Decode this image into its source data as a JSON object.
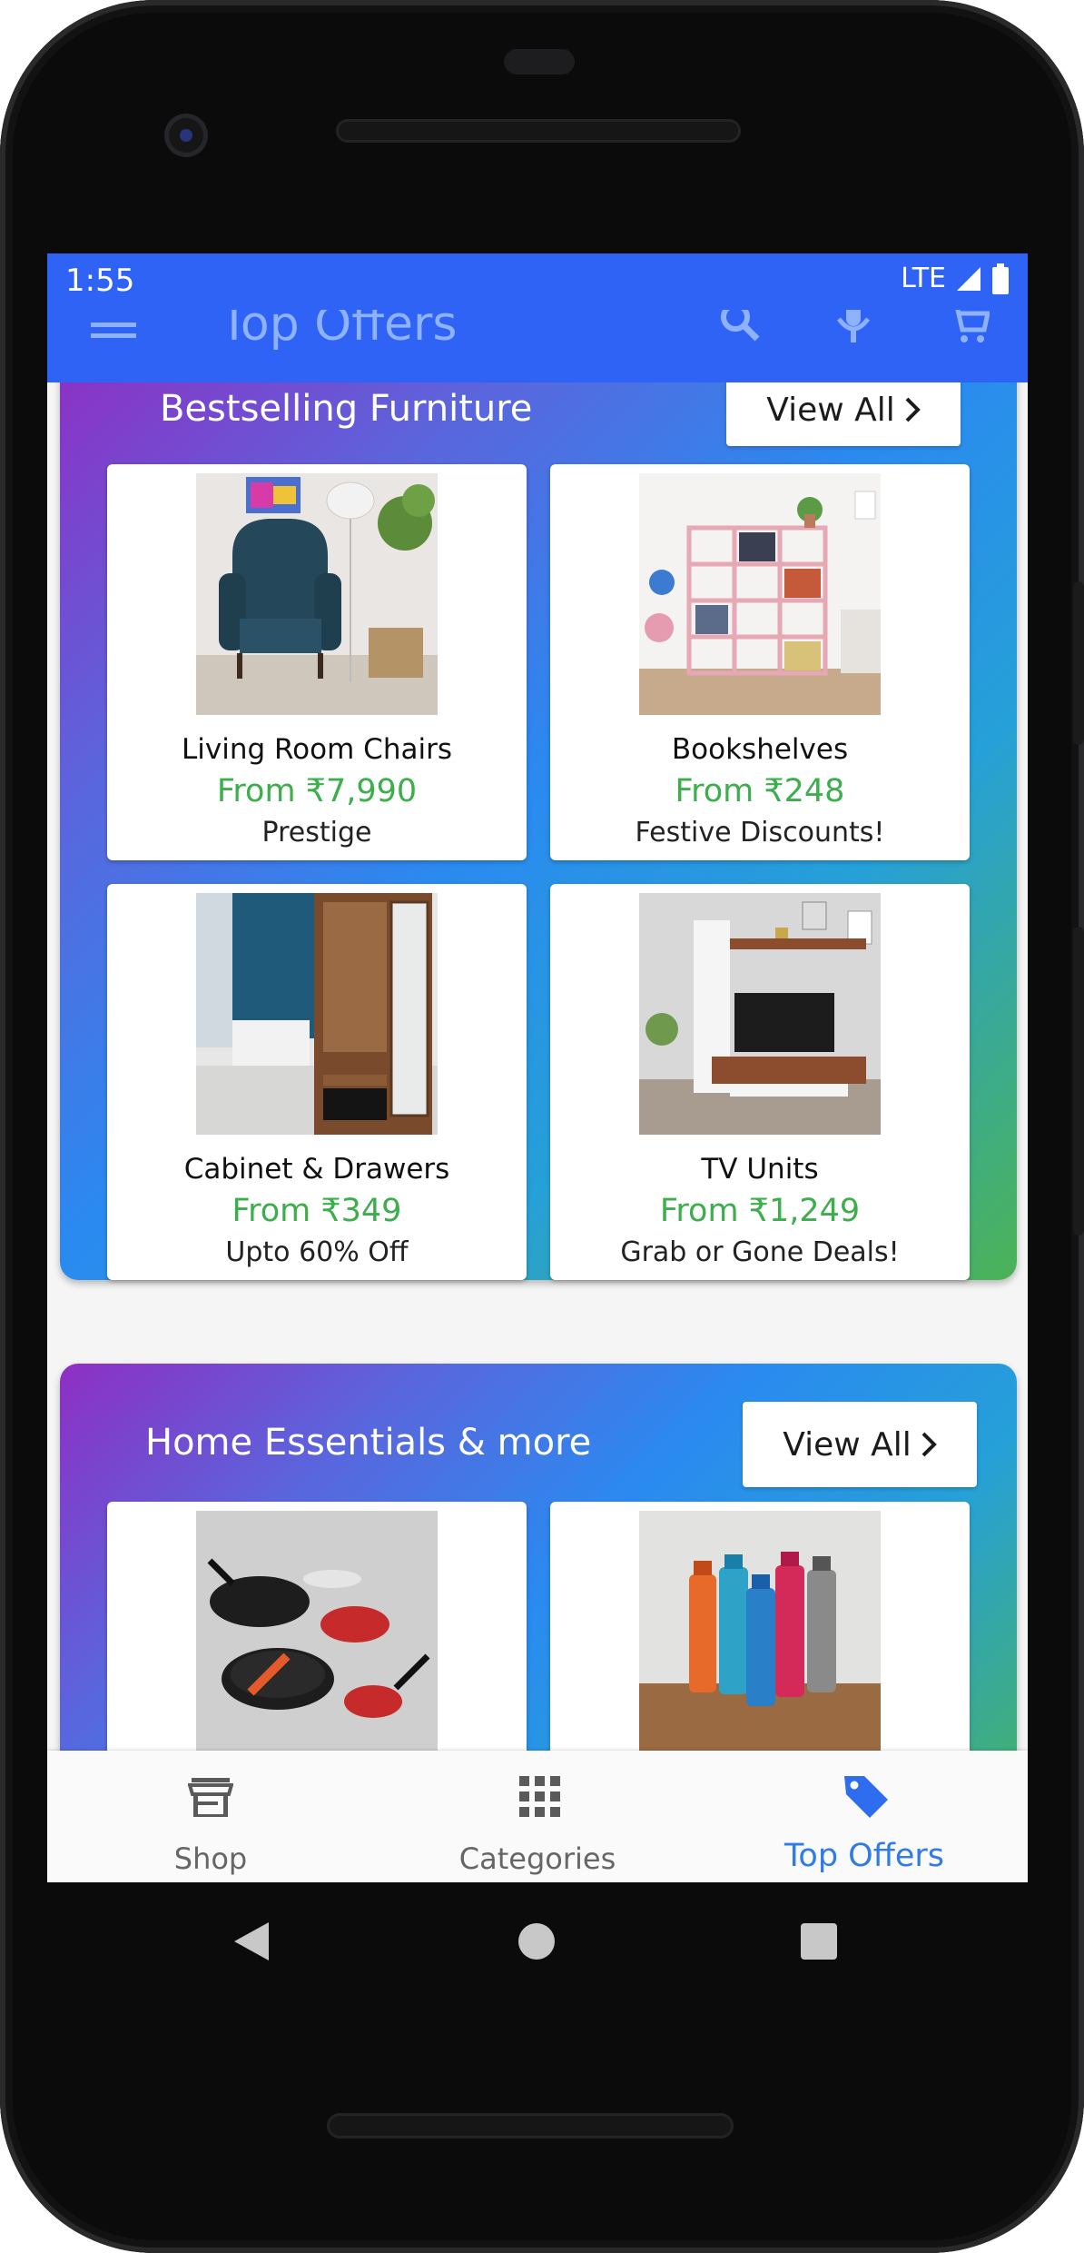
{
  "status": {
    "time": "1:55",
    "network": "LTE"
  },
  "appbar": {
    "title": "Top Offers"
  },
  "sections": [
    {
      "title": "Bestselling Furniture",
      "view_all": "View All",
      "cards": [
        {
          "name": "Living Room Chairs",
          "price": "From ₹7,990",
          "sub": "Prestige"
        },
        {
          "name": "Bookshelves",
          "price": "From ₹248",
          "sub": "Festive Discounts!"
        },
        {
          "name": "Cabinet & Drawers",
          "price": "From ₹349",
          "sub": "Upto 60% Off"
        },
        {
          "name": "TV Units",
          "price": "From ₹1,249",
          "sub": "Grab or Gone Deals!"
        }
      ]
    },
    {
      "title": "Home Essentials & more",
      "view_all": "View All",
      "cards": [
        {
          "name": "",
          "price": "",
          "sub": ""
        },
        {
          "name": "",
          "price": "",
          "sub": ""
        }
      ]
    }
  ],
  "bottom_nav": [
    {
      "label": "Shop",
      "icon": "store-icon",
      "active": false
    },
    {
      "label": "Categories",
      "icon": "grid-icon",
      "active": false
    },
    {
      "label": "Top Offers",
      "icon": "tag-icon",
      "active": true
    }
  ],
  "colors": {
    "primary": "#2f63f5",
    "price_green": "#3cae4c",
    "active_tab": "#2f7be8"
  }
}
